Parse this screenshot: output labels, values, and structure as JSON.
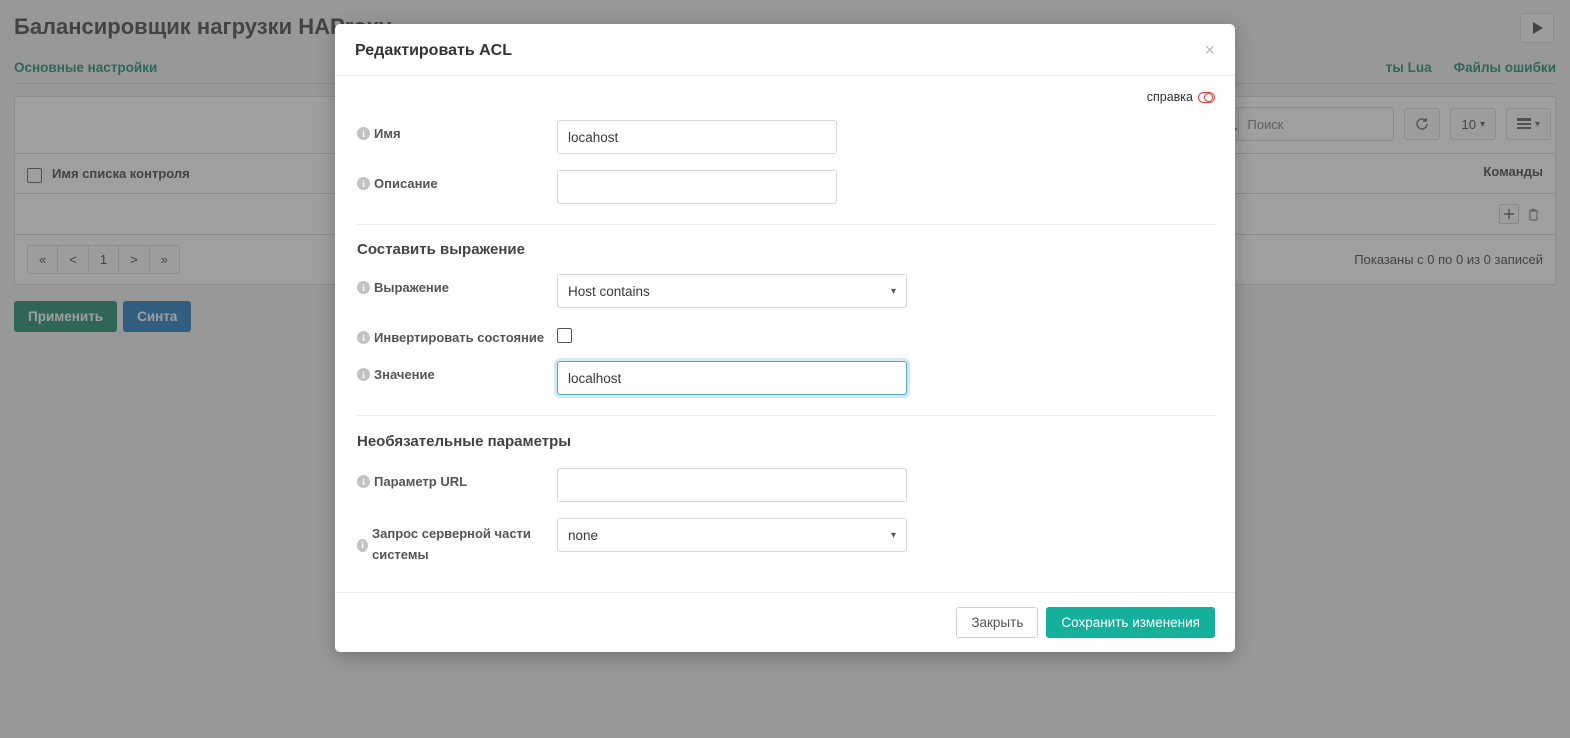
{
  "page": {
    "title": "Балансировщик нагрузки HAProxy",
    "tabs": {
      "main": "Основные настройки",
      "lua": "ты Lua",
      "errors": "Файлы ошибки"
    },
    "search_placeholder": "Поиск",
    "page_size": "10",
    "table": {
      "col_name": "Имя списка контроля",
      "col_cmds": "Команды"
    },
    "pager": {
      "first": "«",
      "prev": "<",
      "page": "1",
      "next": ">",
      "last": "»"
    },
    "info": "Показаны с 0 по 0 из 0 записей",
    "apply_btn": "Применить",
    "syntax_btn": "Синта"
  },
  "modal": {
    "title": "Редактировать ACL",
    "help": "справка",
    "fields": {
      "name_label": "Имя",
      "name_value": "locahost",
      "desc_label": "Описание",
      "desc_value": "",
      "expr_section": "Составить выражение",
      "expr_label": "Выражение",
      "expr_value": "Host contains",
      "invert_label": "Инвертировать состояние",
      "value_label": "Значение",
      "value_value": "localhost",
      "opt_section": "Необязательные параметры",
      "url_label": "Параметр URL",
      "url_value": "",
      "backend_label": "Запрос серверной части системы",
      "backend_value": "none"
    },
    "footer": {
      "close": "Закрыть",
      "save": "Сохранить изменения"
    }
  }
}
